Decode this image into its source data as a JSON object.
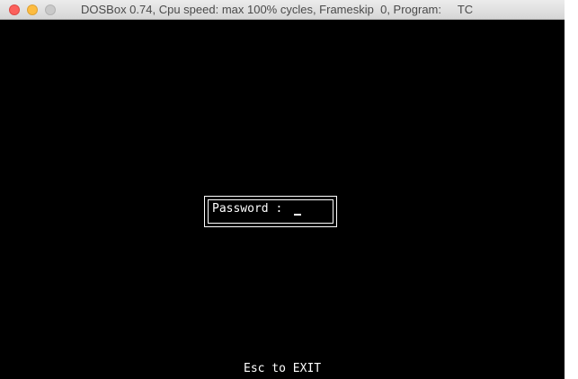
{
  "window": {
    "title": "DOSBox 0.74, Cpu speed: max 100% cycles, Frameskip  0, Program:     TC",
    "buttons": [
      "close",
      "minimize",
      "zoom"
    ]
  },
  "screen": {
    "password_label": "Password :",
    "password_value": "",
    "footer_hint": "Esc to EXIT"
  },
  "colors": {
    "background": "#000000",
    "text": "#ffffff",
    "close": "#fc605c",
    "minimize": "#fdbc40",
    "zoom_inactive": "#c9c9c9"
  }
}
